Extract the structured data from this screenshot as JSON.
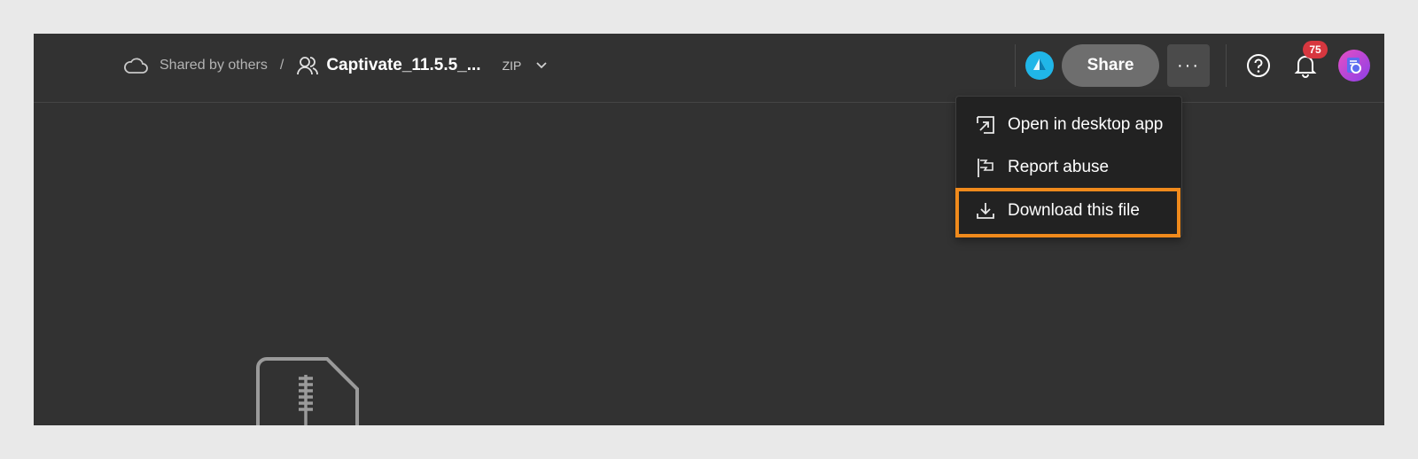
{
  "breadcrumb": {
    "location_label": "Shared by others",
    "separator": "/",
    "file_name": "Captivate_11.5.5_...",
    "file_type": "ZIP"
  },
  "toolbar": {
    "share_label": "Share",
    "more_label": "···",
    "notification_count": "75"
  },
  "menu": {
    "items": [
      {
        "label": "Open in desktop app",
        "icon": "open-external-icon"
      },
      {
        "label": "Report abuse",
        "icon": "flag-icon"
      },
      {
        "label": "Download this file",
        "icon": "download-icon",
        "highlighted": true
      }
    ]
  },
  "colors": {
    "background": "#323232",
    "highlight": "#f08a1c",
    "badge": "#d7373f",
    "share_button": "#6e6e6e"
  }
}
